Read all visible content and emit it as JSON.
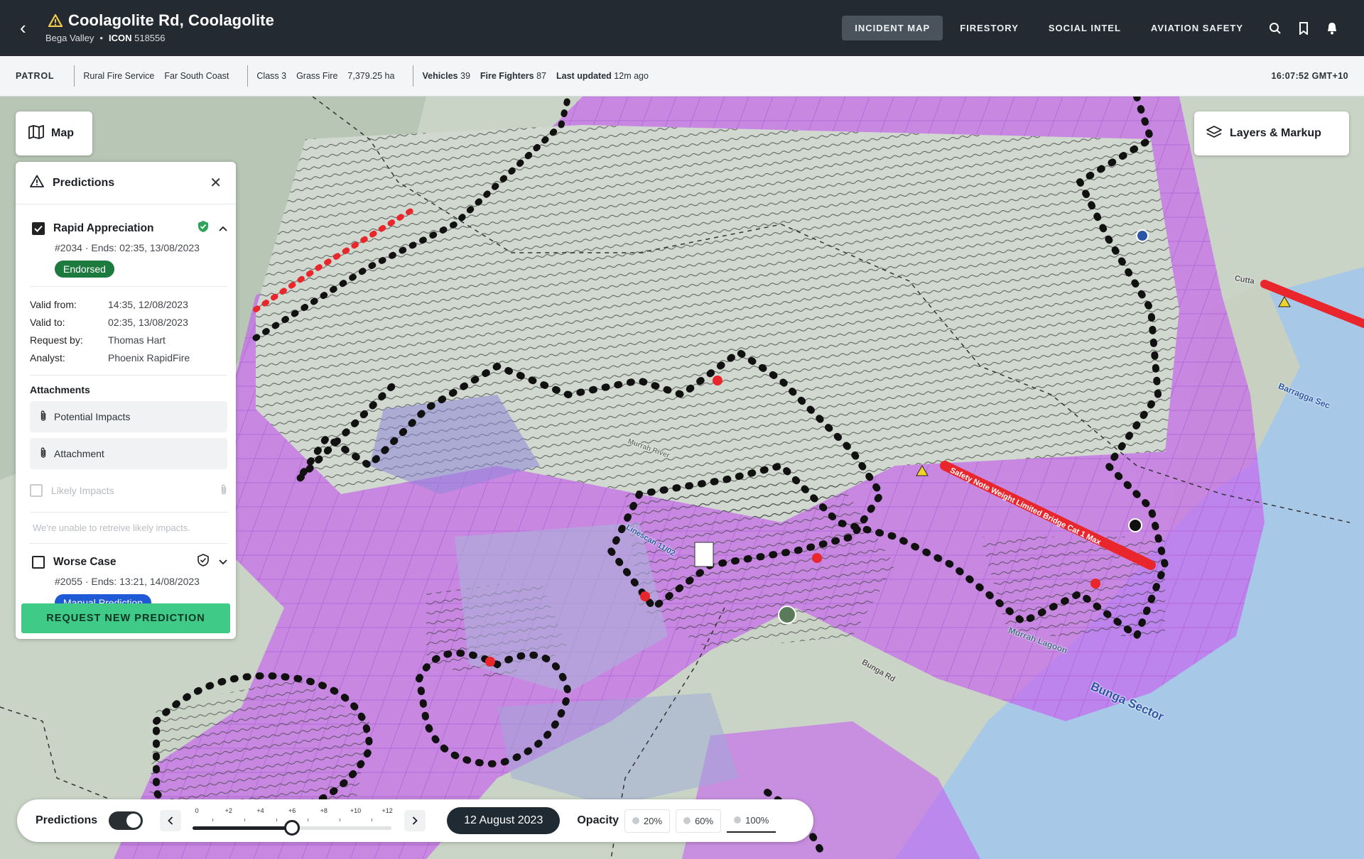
{
  "header": {
    "title": "Coolagolite Rd, Coolagolite",
    "region": "Bega Valley",
    "icon_label": "ICON",
    "icon_number": "518556",
    "tabs": [
      {
        "label": "INCIDENT MAP",
        "active": true
      },
      {
        "label": "FIRESTORY",
        "active": false
      },
      {
        "label": "SOCIAL INTEL",
        "active": false
      },
      {
        "label": "AVIATION SAFETY",
        "active": false
      }
    ],
    "icons": [
      "search-icon",
      "bookmark-icon",
      "bell-icon"
    ]
  },
  "status": {
    "status": "PATROL",
    "agency": "Rural Fire Service",
    "area": "Far South Coast",
    "class": "Class 3",
    "type": "Grass Fire",
    "size": "7,379.25 ha",
    "vehicles_label": "Vehicles",
    "vehicles": "39",
    "firefighters_label": "Fire Fighters",
    "firefighters": "87",
    "updated_label": "Last updated",
    "updated": "12m ago",
    "time": "16:07:52 GMT+10"
  },
  "map": {
    "map_button": "Map",
    "layers_button": "Layers & Markup",
    "labels": [
      "Safety Note Weight Limited Bridge Cat 1 Max",
      "Bunga Sector",
      "Barragga Sec",
      "Murrah Lagoon",
      "Bunga Rd",
      "Linescan 11/02",
      "Murrah River",
      "Cutta"
    ]
  },
  "panel": {
    "title": "Predictions",
    "prediction1": {
      "name": "Rapid Appreciation",
      "id": "#2034",
      "ends": "Ends: 02:35, 13/08/2023",
      "badge": "Endorsed",
      "checked": true
    },
    "details": [
      {
        "k": "Valid from:",
        "v": "14:35, 12/08/2023"
      },
      {
        "k": "Valid to:",
        "v": "02:35, 13/08/2023"
      },
      {
        "k": "Request by:",
        "v": "Thomas Hart"
      },
      {
        "k": "Analyst:",
        "v": "Phoenix RapidFire"
      }
    ],
    "attachments_title": "Attachments",
    "attachments": [
      "Potential Impacts",
      "Attachment"
    ],
    "likely_impacts": "Likely Impacts",
    "likely_msg": "We're unable to retreive likely impacts.",
    "prediction2": {
      "name": "Worse Case",
      "id": "#2055",
      "ends": "Ends: 13:21, 14/08/2023",
      "badge": "Manual Prediction",
      "checked": false
    },
    "request_button": "REQUEST NEW PREDICTION"
  },
  "timeline": {
    "label": "Predictions",
    "toggle_on": true,
    "ticks": [
      "0",
      "+2",
      "+4",
      "+6",
      "+8",
      "+10",
      "+12"
    ],
    "value_hours": 6,
    "max_hours": 12,
    "date": "12 August 2023",
    "opacity_label": "Opacity",
    "opacity_options": [
      "20%",
      "60%",
      "100%"
    ],
    "opacity_selected": "100%"
  }
}
